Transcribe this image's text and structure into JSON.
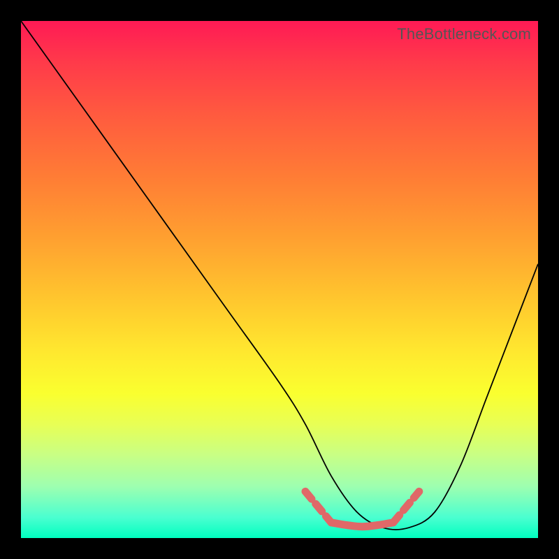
{
  "watermark": "TheBottleneck.com",
  "chart_data": {
    "type": "line",
    "title": "",
    "xlabel": "",
    "ylabel": "",
    "xlim": [
      0,
      100
    ],
    "ylim": [
      0,
      100
    ],
    "grid": false,
    "legend": false,
    "series": [
      {
        "name": "black-curve",
        "x": [
          0,
          10,
          20,
          30,
          40,
          50,
          55,
          60,
          65,
          70,
          75,
          80,
          85,
          90,
          95,
          100
        ],
        "values": [
          100,
          86,
          72,
          58,
          44,
          30,
          22,
          12,
          5,
          2,
          2,
          5,
          14,
          27,
          40,
          53
        ]
      },
      {
        "name": "optimal-flat-segment",
        "x": [
          60,
          63,
          66,
          69,
          72
        ],
        "values": [
          3,
          2.5,
          2.2,
          2.5,
          3
        ]
      }
    ],
    "highlight": {
      "left_dash": {
        "x": [
          55,
          60
        ],
        "values": [
          9,
          3
        ]
      },
      "right_dash": {
        "x": [
          72,
          77
        ],
        "values": [
          3,
          9
        ]
      }
    },
    "background_gradient": {
      "top": "#ff1a55",
      "bottom": "#00ffc0"
    }
  }
}
